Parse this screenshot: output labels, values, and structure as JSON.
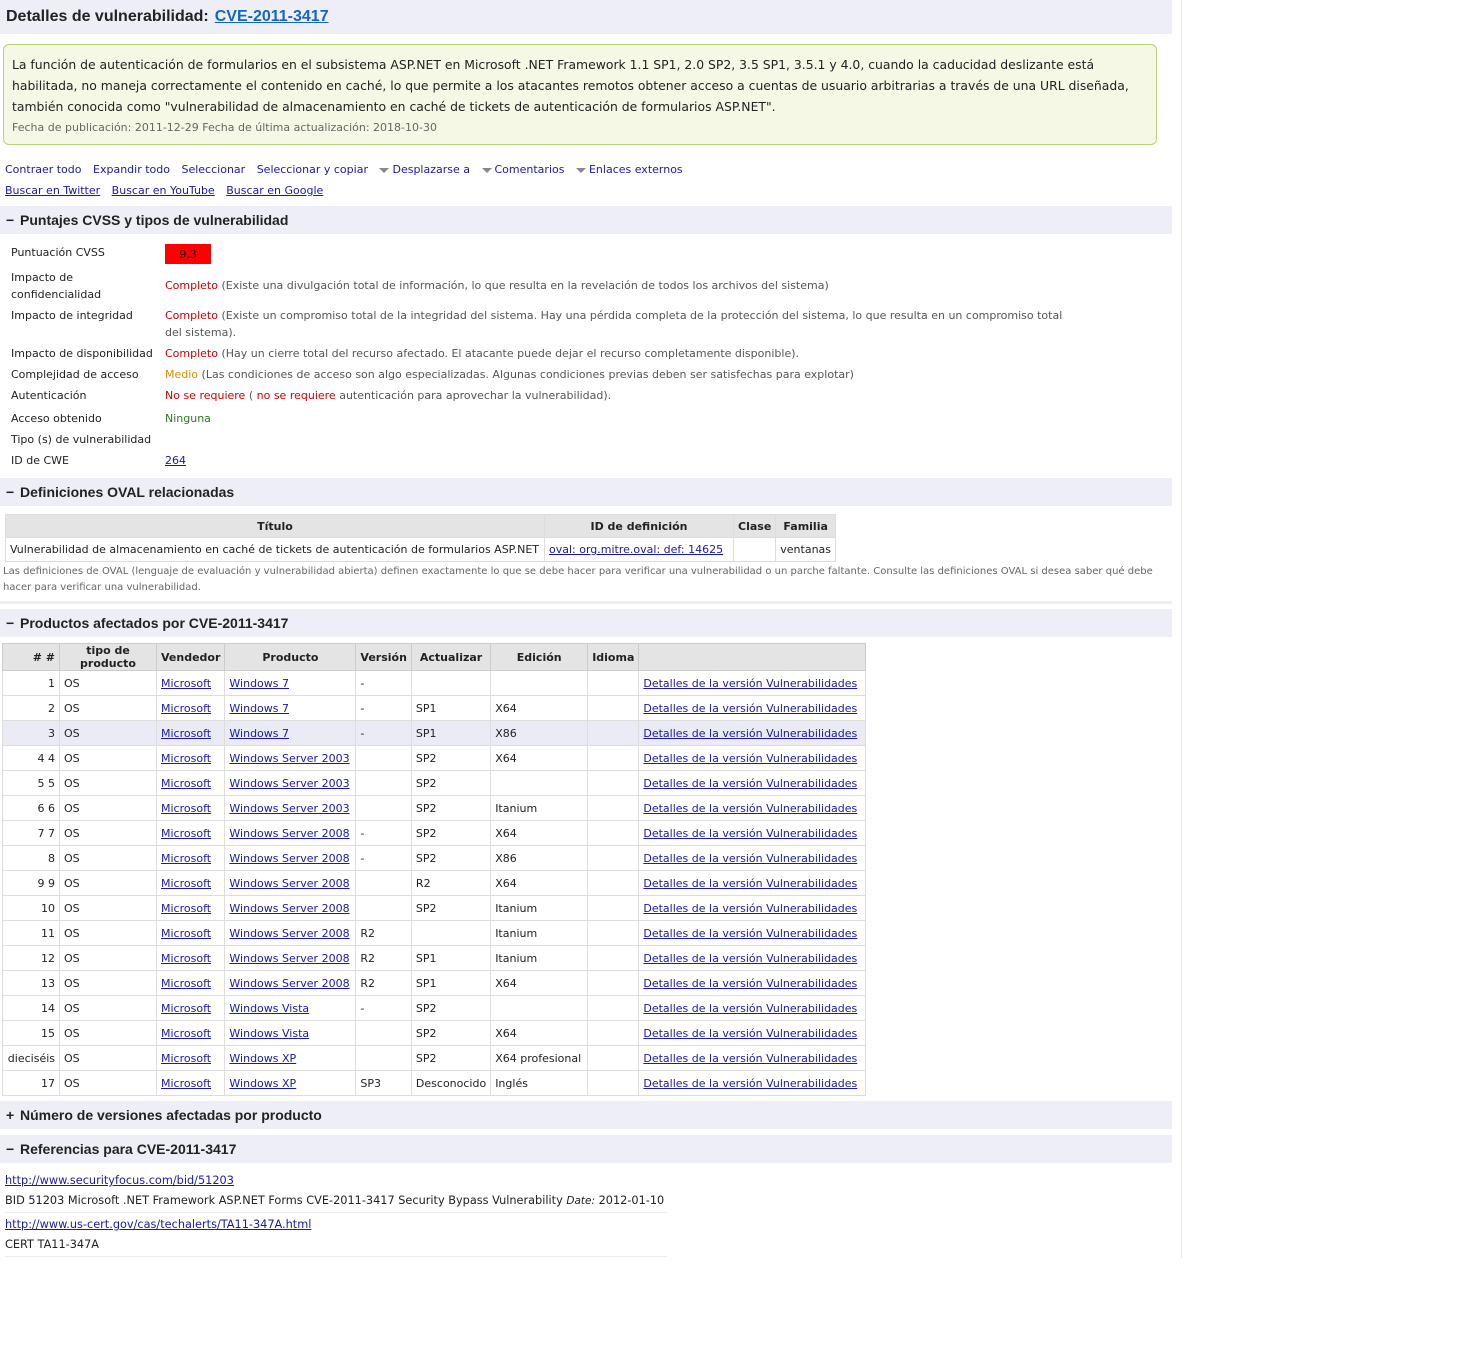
{
  "header": {
    "title": "Detalles de vulnerabilidad:",
    "cve": "CVE-2011-3417"
  },
  "summary": {
    "description": "La función de autenticación de formularios en el subsistema ASP.NET en Microsoft .NET Framework 1.1 SP1, 2.0 SP2, 3.5 SP1, 3.5.1 y 4.0, cuando la caducidad deslizante está habilitada, no maneja correctamente el contenido en caché, lo que permite a los atacantes remotos obtener acceso a cuentas de usuario arbitrarias a través de una URL diseñada, también conocida como \"vulnerabilidad de almacenamiento en caché de tickets de autenticación de formularios ASP.NET\".",
    "dates": "Fecha de publicación: 2011-12-29 Fecha de última actualización: 2018-10-30"
  },
  "actions": {
    "collapse_all": "Contraer todo",
    "expand_all": "Expandir todo",
    "select": "Seleccionar",
    "select_copy": "Seleccionar y copiar",
    "scroll_to": "Desplazarse a",
    "comments": "Comentarios",
    "external_links": "Enlaces externos",
    "search_twitter": "Buscar en Twitter",
    "search_youtube": "Buscar en YouTube",
    "search_google": "Buscar en Google"
  },
  "cvss_section": {
    "toggle": "−",
    "title": "Puntajes CVSS y tipos de vulnerabilidad",
    "score_label": "Puntuación CVSS",
    "score": "9.3",
    "score_color": "#ff0000",
    "conf_label": "Impacto de confidencialidad",
    "conf_value": "Completo",
    "conf_desc": "(Existe una divulgación total de información, lo que resulta en la revelación de todos los archivos del sistema)",
    "integ_label": "Impacto de integridad",
    "integ_value": "Completo",
    "integ_desc": "(Existe un compromiso total de la integridad del sistema. Hay una pérdida completa de la protección del sistema, lo que resulta en un compromiso total del sistema).",
    "avail_label": "Impacto de disponibilidad",
    "avail_value": "Completo",
    "avail_desc": "(Hay un cierre total del recurso afectado. El atacante puede dejar el recurso completamente disponible).",
    "complex_label": "Complejidad de acceso",
    "complex_value": "Medio",
    "complex_desc": "(Las condiciones de acceso son algo especializadas. Algunas condiciones previas deben ser satisfechas para explotar)",
    "auth_label": "Autenticación",
    "auth_value": "No se requiere",
    "auth_open": "(",
    "auth_value2": "no se requiere",
    "auth_desc": "autenticación para aprovechar la vulnerabilidad).",
    "access_label": "Acceso obtenido",
    "access_value": "Ninguna",
    "type_label": "Tipo (s) de vulnerabilidad",
    "cwe_label": "ID de CWE",
    "cwe_value": "264"
  },
  "oval_section": {
    "toggle": "−",
    "title": "Definiciones OVAL relacionadas",
    "headers": [
      "Título",
      "ID de definición",
      "Clase",
      "Familia"
    ],
    "row": {
      "title": "Vulnerabilidad de almacenamiento en caché de tickets de autenticación de formularios ASP.NET",
      "id": "oval: org.mitre.oval: def: 14625",
      "class": "",
      "family": "ventanas"
    },
    "note": "Las definiciones de OVAL (lenguaje de evaluación y vulnerabilidad abierta) definen exactamente lo que se debe hacer para verificar una vulnerabilidad o un parche faltante. Consulte las definiciones OVAL si desea saber qué debe hacer para verificar una vulnerabilidad."
  },
  "products_section": {
    "toggle": "−",
    "title": "Productos afectados por CVE-2011-3417",
    "headers": [
      "# #",
      "tipo de producto",
      "Vendedor",
      "Producto",
      "Versión",
      "Actualizar",
      "Edición",
      "Idioma",
      ""
    ],
    "details_link": "Detalles de la versión ",
    "vulns_link": "Vulnerabilidades",
    "rows": [
      {
        "n": "1",
        "type": "OS",
        "vendor": "Microsoft",
        "product": "Windows 7",
        "version": "-",
        "update": "",
        "edition": "",
        "lang": ""
      },
      {
        "n": "2",
        "type": "OS",
        "vendor": "Microsoft",
        "product": "Windows 7",
        "version": "-",
        "update": "SP1",
        "edition": "X64",
        "lang": ""
      },
      {
        "n": "3",
        "type": "OS",
        "vendor": "Microsoft",
        "product": "Windows 7",
        "version": "-",
        "update": "SP1",
        "edition": "X86",
        "lang": ""
      },
      {
        "n": "4 4",
        "type": "OS",
        "vendor": "Microsoft",
        "product": "Windows Server 2003",
        "version": "",
        "update": "SP2",
        "edition": "X64",
        "lang": ""
      },
      {
        "n": "5 5",
        "type": "OS",
        "vendor": "Microsoft",
        "product": "Windows Server 2003",
        "version": "",
        "update": "SP2",
        "edition": "",
        "lang": ""
      },
      {
        "n": "6 6",
        "type": "OS",
        "vendor": "Microsoft",
        "product": "Windows Server 2003",
        "version": "",
        "update": "SP2",
        "edition": "Itanium",
        "lang": ""
      },
      {
        "n": "7 7",
        "type": "OS",
        "vendor": "Microsoft",
        "product": "Windows Server 2008",
        "version": "-",
        "update": "SP2",
        "edition": "X64",
        "lang": ""
      },
      {
        "n": "8",
        "type": "OS",
        "vendor": "Microsoft",
        "product": "Windows Server 2008",
        "version": "-",
        "update": "SP2",
        "edition": "X86",
        "lang": ""
      },
      {
        "n": "9 9",
        "type": "OS",
        "vendor": "Microsoft",
        "product": "Windows Server 2008",
        "version": "",
        "update": "R2",
        "edition": "X64",
        "lang": ""
      },
      {
        "n": "10",
        "type": "OS",
        "vendor": "Microsoft",
        "product": "Windows Server 2008",
        "version": "",
        "update": "SP2",
        "edition": "Itanium",
        "lang": ""
      },
      {
        "n": "11",
        "type": "OS",
        "vendor": "Microsoft",
        "product": "Windows Server 2008",
        "version": "R2",
        "update": "",
        "edition": "Itanium",
        "lang": ""
      },
      {
        "n": "12",
        "type": "OS",
        "vendor": "Microsoft",
        "product": "Windows Server 2008",
        "version": "R2",
        "update": "SP1",
        "edition": "Itanium",
        "lang": ""
      },
      {
        "n": "13",
        "type": "OS",
        "vendor": "Microsoft",
        "product": "Windows Server 2008",
        "version": "R2",
        "update": "SP1",
        "edition": "X64",
        "lang": ""
      },
      {
        "n": "14",
        "type": "OS",
        "vendor": "Microsoft",
        "product": "Windows Vista",
        "version": "-",
        "update": "SP2",
        "edition": "",
        "lang": ""
      },
      {
        "n": "15",
        "type": "OS",
        "vendor": "Microsoft",
        "product": "Windows Vista",
        "version": "",
        "update": "SP2",
        "edition": "X64",
        "lang": ""
      },
      {
        "n": "dieciséis",
        "type": "OS",
        "vendor": "Microsoft",
        "product": "Windows XP",
        "version": "",
        "update": "SP2",
        "edition": "X64 profesional",
        "lang": ""
      },
      {
        "n": "17",
        "type": "OS",
        "vendor": "Microsoft",
        "product": "Windows XP",
        "version": "SP3",
        "update": "Desconocido",
        "edition": "Inglés",
        "lang": ""
      }
    ]
  },
  "versions_section": {
    "toggle": "+",
    "title": "Número de versiones afectadas por producto"
  },
  "refs_section": {
    "toggle": "−",
    "title": "Referencias para CVE-2011-3417",
    "refs": [
      {
        "url": "http://www.securityfocus.com/bid/51203",
        "text": "BID 51203 Microsoft .NET Framework ASP.NET Forms CVE-2011-3417 Security Bypass Vulnerability",
        "date_label": "Date:",
        "date": "2012-01-10"
      },
      {
        "url": "http://www.us-cert.gov/cas/techalerts/TA11-347A.html",
        "text": "CERT TA11-347A",
        "date_label": "",
        "date": ""
      }
    ]
  }
}
